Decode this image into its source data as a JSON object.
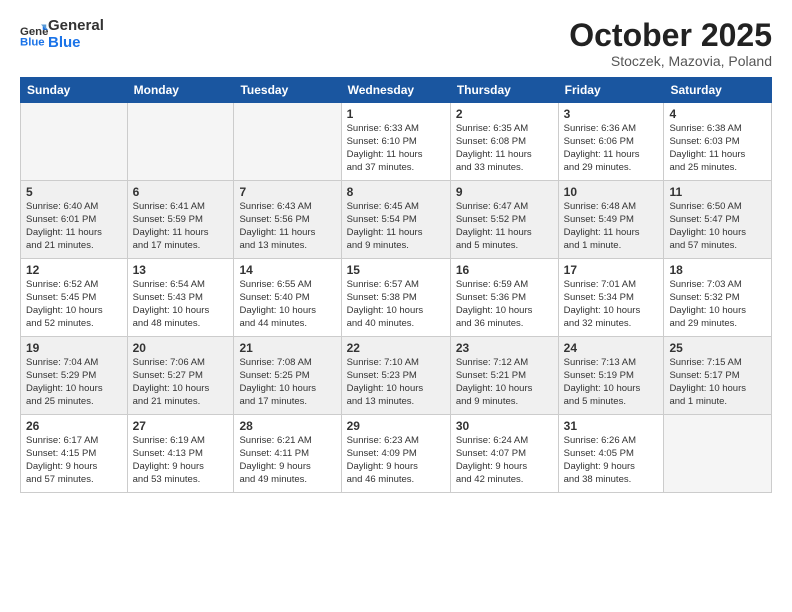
{
  "logo": {
    "line1": "General",
    "line2": "Blue"
  },
  "title": "October 2025",
  "location": "Stoczek, Mazovia, Poland",
  "days_of_week": [
    "Sunday",
    "Monday",
    "Tuesday",
    "Wednesday",
    "Thursday",
    "Friday",
    "Saturday"
  ],
  "weeks": [
    [
      {
        "day": "",
        "text": ""
      },
      {
        "day": "",
        "text": ""
      },
      {
        "day": "",
        "text": ""
      },
      {
        "day": "1",
        "text": "Sunrise: 6:33 AM\nSunset: 6:10 PM\nDaylight: 11 hours\nand 37 minutes."
      },
      {
        "day": "2",
        "text": "Sunrise: 6:35 AM\nSunset: 6:08 PM\nDaylight: 11 hours\nand 33 minutes."
      },
      {
        "day": "3",
        "text": "Sunrise: 6:36 AM\nSunset: 6:06 PM\nDaylight: 11 hours\nand 29 minutes."
      },
      {
        "day": "4",
        "text": "Sunrise: 6:38 AM\nSunset: 6:03 PM\nDaylight: 11 hours\nand 25 minutes."
      }
    ],
    [
      {
        "day": "5",
        "text": "Sunrise: 6:40 AM\nSunset: 6:01 PM\nDaylight: 11 hours\nand 21 minutes."
      },
      {
        "day": "6",
        "text": "Sunrise: 6:41 AM\nSunset: 5:59 PM\nDaylight: 11 hours\nand 17 minutes."
      },
      {
        "day": "7",
        "text": "Sunrise: 6:43 AM\nSunset: 5:56 PM\nDaylight: 11 hours\nand 13 minutes."
      },
      {
        "day": "8",
        "text": "Sunrise: 6:45 AM\nSunset: 5:54 PM\nDaylight: 11 hours\nand 9 minutes."
      },
      {
        "day": "9",
        "text": "Sunrise: 6:47 AM\nSunset: 5:52 PM\nDaylight: 11 hours\nand 5 minutes."
      },
      {
        "day": "10",
        "text": "Sunrise: 6:48 AM\nSunset: 5:49 PM\nDaylight: 11 hours\nand 1 minute."
      },
      {
        "day": "11",
        "text": "Sunrise: 6:50 AM\nSunset: 5:47 PM\nDaylight: 10 hours\nand 57 minutes."
      }
    ],
    [
      {
        "day": "12",
        "text": "Sunrise: 6:52 AM\nSunset: 5:45 PM\nDaylight: 10 hours\nand 52 minutes."
      },
      {
        "day": "13",
        "text": "Sunrise: 6:54 AM\nSunset: 5:43 PM\nDaylight: 10 hours\nand 48 minutes."
      },
      {
        "day": "14",
        "text": "Sunrise: 6:55 AM\nSunset: 5:40 PM\nDaylight: 10 hours\nand 44 minutes."
      },
      {
        "day": "15",
        "text": "Sunrise: 6:57 AM\nSunset: 5:38 PM\nDaylight: 10 hours\nand 40 minutes."
      },
      {
        "day": "16",
        "text": "Sunrise: 6:59 AM\nSunset: 5:36 PM\nDaylight: 10 hours\nand 36 minutes."
      },
      {
        "day": "17",
        "text": "Sunrise: 7:01 AM\nSunset: 5:34 PM\nDaylight: 10 hours\nand 32 minutes."
      },
      {
        "day": "18",
        "text": "Sunrise: 7:03 AM\nSunset: 5:32 PM\nDaylight: 10 hours\nand 29 minutes."
      }
    ],
    [
      {
        "day": "19",
        "text": "Sunrise: 7:04 AM\nSunset: 5:29 PM\nDaylight: 10 hours\nand 25 minutes."
      },
      {
        "day": "20",
        "text": "Sunrise: 7:06 AM\nSunset: 5:27 PM\nDaylight: 10 hours\nand 21 minutes."
      },
      {
        "day": "21",
        "text": "Sunrise: 7:08 AM\nSunset: 5:25 PM\nDaylight: 10 hours\nand 17 minutes."
      },
      {
        "day": "22",
        "text": "Sunrise: 7:10 AM\nSunset: 5:23 PM\nDaylight: 10 hours\nand 13 minutes."
      },
      {
        "day": "23",
        "text": "Sunrise: 7:12 AM\nSunset: 5:21 PM\nDaylight: 10 hours\nand 9 minutes."
      },
      {
        "day": "24",
        "text": "Sunrise: 7:13 AM\nSunset: 5:19 PM\nDaylight: 10 hours\nand 5 minutes."
      },
      {
        "day": "25",
        "text": "Sunrise: 7:15 AM\nSunset: 5:17 PM\nDaylight: 10 hours\nand 1 minute."
      }
    ],
    [
      {
        "day": "26",
        "text": "Sunrise: 6:17 AM\nSunset: 4:15 PM\nDaylight: 9 hours\nand 57 minutes."
      },
      {
        "day": "27",
        "text": "Sunrise: 6:19 AM\nSunset: 4:13 PM\nDaylight: 9 hours\nand 53 minutes."
      },
      {
        "day": "28",
        "text": "Sunrise: 6:21 AM\nSunset: 4:11 PM\nDaylight: 9 hours\nand 49 minutes."
      },
      {
        "day": "29",
        "text": "Sunrise: 6:23 AM\nSunset: 4:09 PM\nDaylight: 9 hours\nand 46 minutes."
      },
      {
        "day": "30",
        "text": "Sunrise: 6:24 AM\nSunset: 4:07 PM\nDaylight: 9 hours\nand 42 minutes."
      },
      {
        "day": "31",
        "text": "Sunrise: 6:26 AM\nSunset: 4:05 PM\nDaylight: 9 hours\nand 38 minutes."
      },
      {
        "day": "",
        "text": ""
      }
    ]
  ]
}
